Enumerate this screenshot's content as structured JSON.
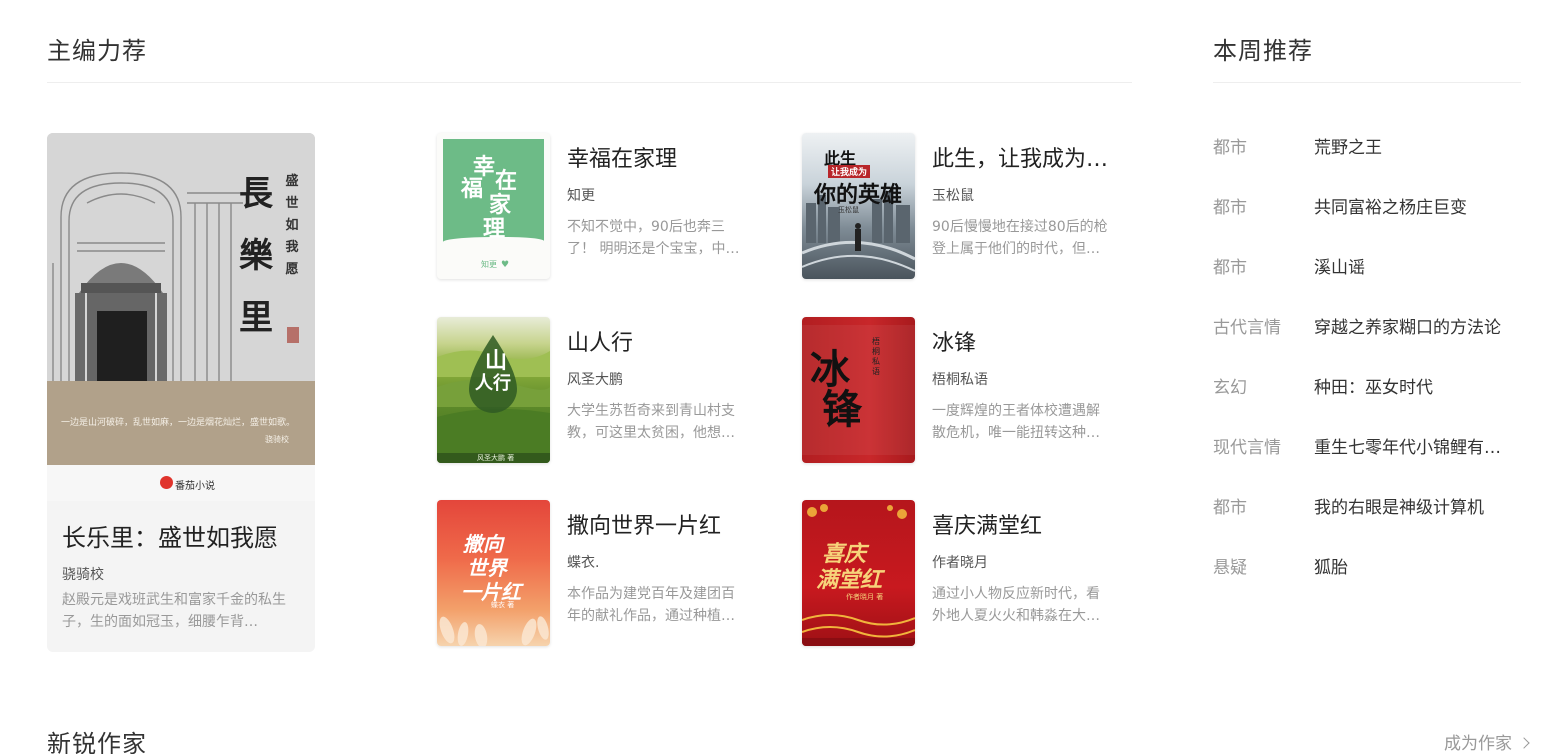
{
  "featured_section": {
    "title": "主编力荐"
  },
  "weekly_section": {
    "title": "本周推荐"
  },
  "new_writers_section": {
    "title": "新锐作家",
    "cta": "成为作家"
  },
  "featured_book": {
    "title": "长乐里：盛世如我愿",
    "author": "骁骑校",
    "description": "赵殿元是戏班武生和富家千金的私生子，生的面如冠玉，细腰乍背…",
    "cover": {
      "vertical_title": [
        "長",
        "樂",
        "里"
      ],
      "vertical_subtitle": [
        "盛",
        "世",
        "如",
        "我",
        "愿"
      ],
      "band_text": "一边是山河破碎，乱世如麻，一边是烟花灿烂，盛世如歌。",
      "band_author": "骁骑校",
      "publisher": "番茄小说"
    }
  },
  "books": [
    {
      "title": "幸福在家理",
      "author": "知更",
      "desc_lines": [
        "不知不觉中，90后也奔三",
        "了！ 明明还是个宝宝，中…"
      ],
      "cover_text": [
        "幸",
        "福",
        "在",
        "家",
        "理"
      ],
      "cover_author": "知更"
    },
    {
      "title": "此生，让我成为…",
      "author": "玉松鼠",
      "desc_lines": [
        "90后慢慢地在接过80后的枪",
        "登上属于他们的时代，但…"
      ],
      "cover_text": [
        "此生",
        "让我成为",
        "你的英雄"
      ],
      "cover_author": "玉松鼠"
    },
    {
      "title": "山人行",
      "author": "风圣大鹏",
      "desc_lines": [
        "大学生苏哲奇来到青山村支",
        "教，可这里太贫困，他想…"
      ],
      "cover_text": [
        "山",
        "人行"
      ],
      "cover_author": "风圣大鹏 著"
    },
    {
      "title": "冰锋",
      "author": "梧桐私语",
      "desc_lines": [
        "一度辉煌的王者体校遭遇解",
        "散危机，唯一能扭转这种…"
      ],
      "cover_text": [
        "冰",
        "锋"
      ],
      "cover_author": "梧桐私语"
    },
    {
      "title": "撒向世界一片红",
      "author": "蝶衣.",
      "desc_lines": [
        "本作品为建党百年及建团百",
        "年的献礼作品，通过种植…"
      ],
      "cover_text": [
        "撒向",
        "世界",
        "一片红"
      ],
      "cover_author": "蝶衣 著"
    },
    {
      "title": "喜庆满堂红",
      "author": "作者晓月",
      "desc_lines": [
        "通过小人物反应新时代，看",
        "外地人夏火火和韩淼在大…"
      ],
      "cover_text": [
        "喜庆",
        "满堂红"
      ],
      "cover_author": "作者晓月 著"
    }
  ],
  "weekly": [
    {
      "category": "都市",
      "title": "荒野之王"
    },
    {
      "category": "都市",
      "title": "共同富裕之杨庄巨变"
    },
    {
      "category": "都市",
      "title": "溪山谣"
    },
    {
      "category": "古代言情",
      "title": "穿越之养家糊口的方法论"
    },
    {
      "category": "玄幻",
      "title": "种田：巫女时代"
    },
    {
      "category": "现代言情",
      "title": "重生七零年代小锦鲤有…"
    },
    {
      "category": "都市",
      "title": "我的右眼是神级计算机"
    },
    {
      "category": "悬疑",
      "title": "狐胎"
    }
  ]
}
